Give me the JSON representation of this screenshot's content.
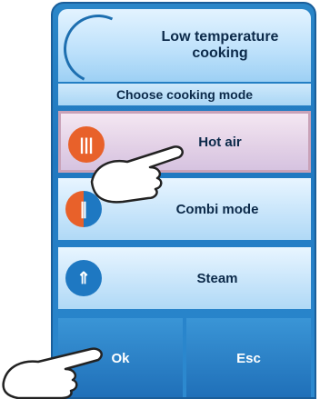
{
  "header": {
    "title": "Low temperature cooking"
  },
  "subheader": {
    "text": "Choose cooking mode"
  },
  "modes": [
    {
      "label": "Hot air",
      "icon": "hot-air-icon",
      "selected": true
    },
    {
      "label": "Combi mode",
      "icon": "combi-mode-icon",
      "selected": false
    },
    {
      "label": "Steam",
      "icon": "steam-icon",
      "selected": false
    }
  ],
  "buttons": {
    "ok": "Ok",
    "esc": "Esc"
  },
  "colors": {
    "panel": "#1f78c0",
    "accent_orange": "#e8612a",
    "accent_blue": "#1e78c2",
    "selected_border": "#c9a2b8"
  }
}
